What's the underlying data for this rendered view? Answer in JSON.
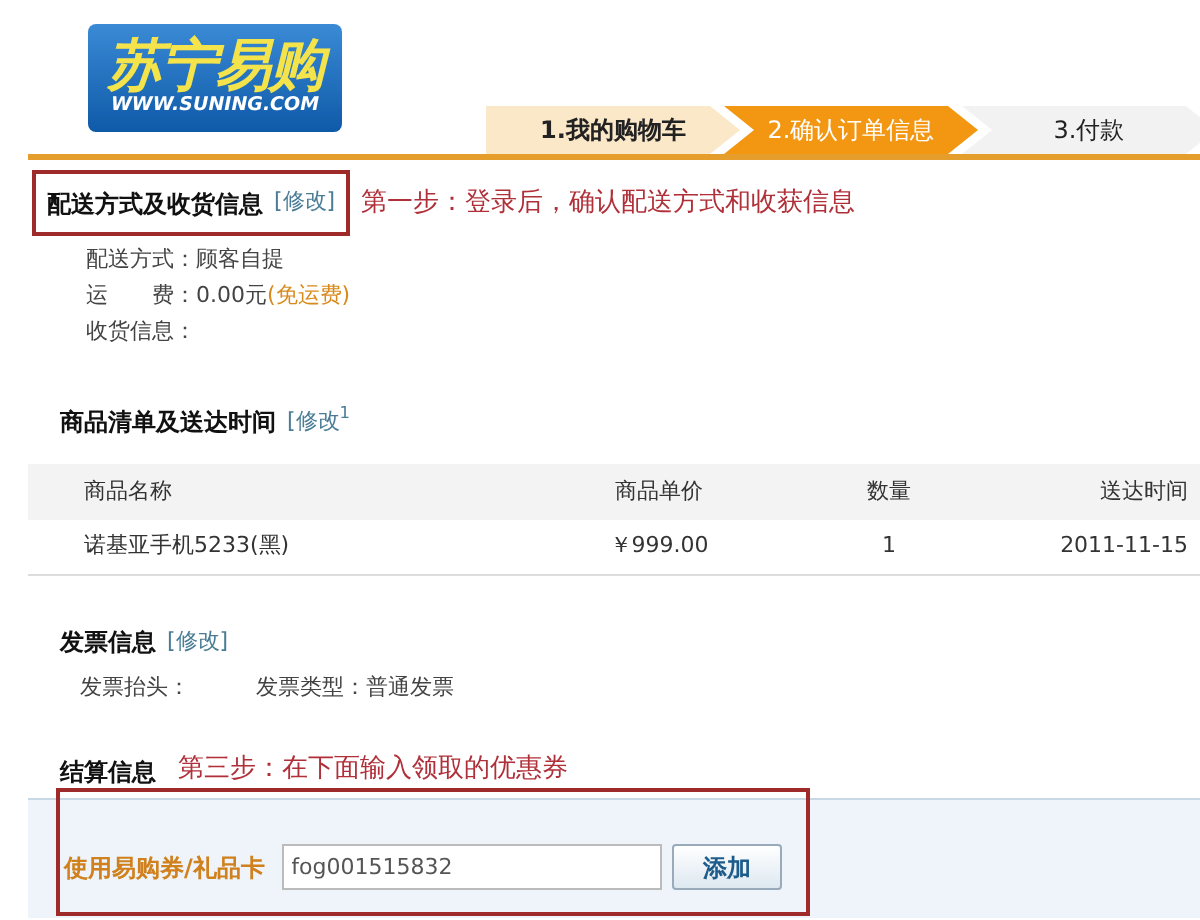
{
  "logo": {
    "name": "苏宁易购",
    "url": "WWW.SUNING.COM"
  },
  "steps": [
    {
      "label": "1.我的购物车",
      "selected": false,
      "completed": true
    },
    {
      "label": "2.确认订单信息",
      "selected": true,
      "completed": false
    },
    {
      "label": "3.付款",
      "selected": false,
      "completed": false
    }
  ],
  "delivery": {
    "title": "配送方式及收货信息",
    "edit": "[修改]",
    "annotation": "第一步：登录后，确认配送方式和收获信息",
    "fields": [
      {
        "label": "配送方式：",
        "value": "顾客自提"
      },
      {
        "label": "运　　费：",
        "value": "0.00元",
        "note": "(免运费)"
      },
      {
        "label": "收货信息："
      }
    ]
  },
  "items": {
    "title": "商品清单及送达时间",
    "edit": "[修改$^{1}$",
    "columns": [
      "商品名称",
      "商品单价",
      "数量",
      "送达时间"
    ],
    "rows": [
      [
        "诺基亚手机5233(黑)",
        "￥999.00",
        "1",
        "2011-11-15"
      ]
    ]
  },
  "invoice": {
    "title": "发票信息",
    "edit": "[修改]",
    "fields": [
      {
        "label": "发票抬头："
      },
      {
        "label": "发票类型：",
        "value": "普通发票"
      }
    ]
  },
  "settlement": {
    "title": "结算信息",
    "annotation": "第三步：在下面输入领取的优惠券",
    "coupon_label": "使用易购券/礼品卡",
    "coupon_value": "fog001515832",
    "add_button": "添加"
  }
}
